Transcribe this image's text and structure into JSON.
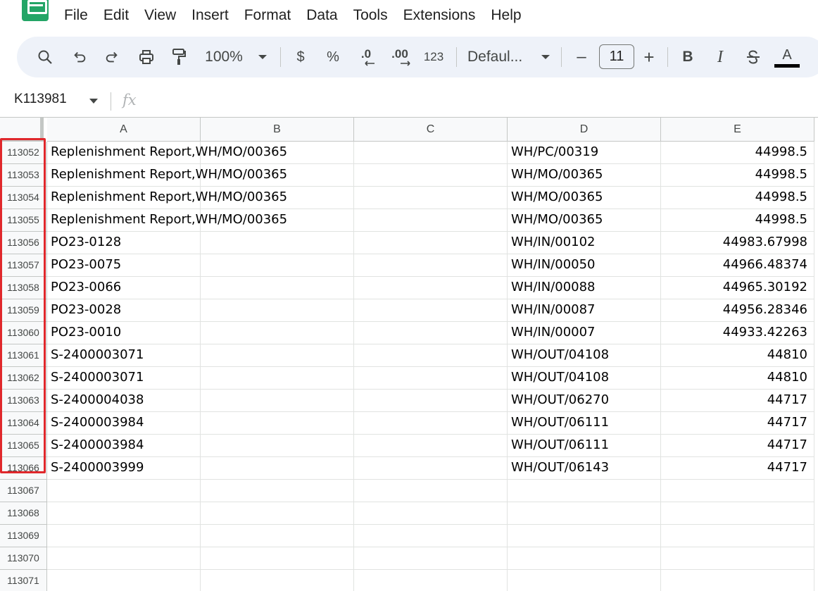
{
  "menu": [
    "File",
    "Edit",
    "View",
    "Insert",
    "Format",
    "Data",
    "Tools",
    "Extensions",
    "Help"
  ],
  "toolbar": {
    "zoom": "100%",
    "currency": "$",
    "percent": "%",
    "dec_decrease": ".0",
    "dec_increase": ".00",
    "number_format": "123",
    "font": "Defaul...",
    "font_size": "11",
    "minus": "–",
    "plus": "+",
    "bold": "B",
    "italic": "I",
    "text_color": "A"
  },
  "formula_bar": {
    "name_box": "K113981",
    "fx": "fx"
  },
  "columns": [
    "A",
    "B",
    "C",
    "D",
    "E"
  ],
  "rows": [
    {
      "num": "113052",
      "a": "Replenishment Report,WH/MO/00365",
      "d": "WH/PC/00319",
      "e": "44998.5"
    },
    {
      "num": "113053",
      "a": "Replenishment Report,WH/MO/00365",
      "d": "WH/MO/00365",
      "e": "44998.5"
    },
    {
      "num": "113054",
      "a": "Replenishment Report,WH/MO/00365",
      "d": "WH/MO/00365",
      "e": "44998.5"
    },
    {
      "num": "113055",
      "a": "Replenishment Report,WH/MO/00365",
      "d": "WH/MO/00365",
      "e": "44998.5"
    },
    {
      "num": "113056",
      "a": "PO23-0128",
      "d": "WH/IN/00102",
      "e": "44983.67998"
    },
    {
      "num": "113057",
      "a": "PO23-0075",
      "d": "WH/IN/00050",
      "e": "44966.48374"
    },
    {
      "num": "113058",
      "a": "PO23-0066",
      "d": "WH/IN/00088",
      "e": "44965.30192"
    },
    {
      "num": "113059",
      "a": "PO23-0028",
      "d": "WH/IN/00087",
      "e": "44956.28346"
    },
    {
      "num": "113060",
      "a": "PO23-0010",
      "d": "WH/IN/00007",
      "e": "44933.42263"
    },
    {
      "num": "113061",
      "a": "S-2400003071",
      "d": "WH/OUT/04108",
      "e": "44810"
    },
    {
      "num": "113062",
      "a": "S-2400003071",
      "d": "WH/OUT/04108",
      "e": "44810"
    },
    {
      "num": "113063",
      "a": "S-2400004038",
      "d": "WH/OUT/06270",
      "e": "44717"
    },
    {
      "num": "113064",
      "a": "S-2400003984",
      "d": "WH/OUT/06111",
      "e": "44717"
    },
    {
      "num": "113065",
      "a": "S-2400003984",
      "d": "WH/OUT/06111",
      "e": "44717"
    },
    {
      "num": "113066",
      "a": "S-2400003999",
      "d": "WH/OUT/06143",
      "e": "44717"
    },
    {
      "num": "113067",
      "a": "",
      "d": "",
      "e": ""
    },
    {
      "num": "113068",
      "a": "",
      "d": "",
      "e": ""
    },
    {
      "num": "113069",
      "a": "",
      "d": "",
      "e": ""
    },
    {
      "num": "113070",
      "a": "",
      "d": "",
      "e": ""
    },
    {
      "num": "113071",
      "a": "",
      "d": "",
      "e": ""
    }
  ]
}
